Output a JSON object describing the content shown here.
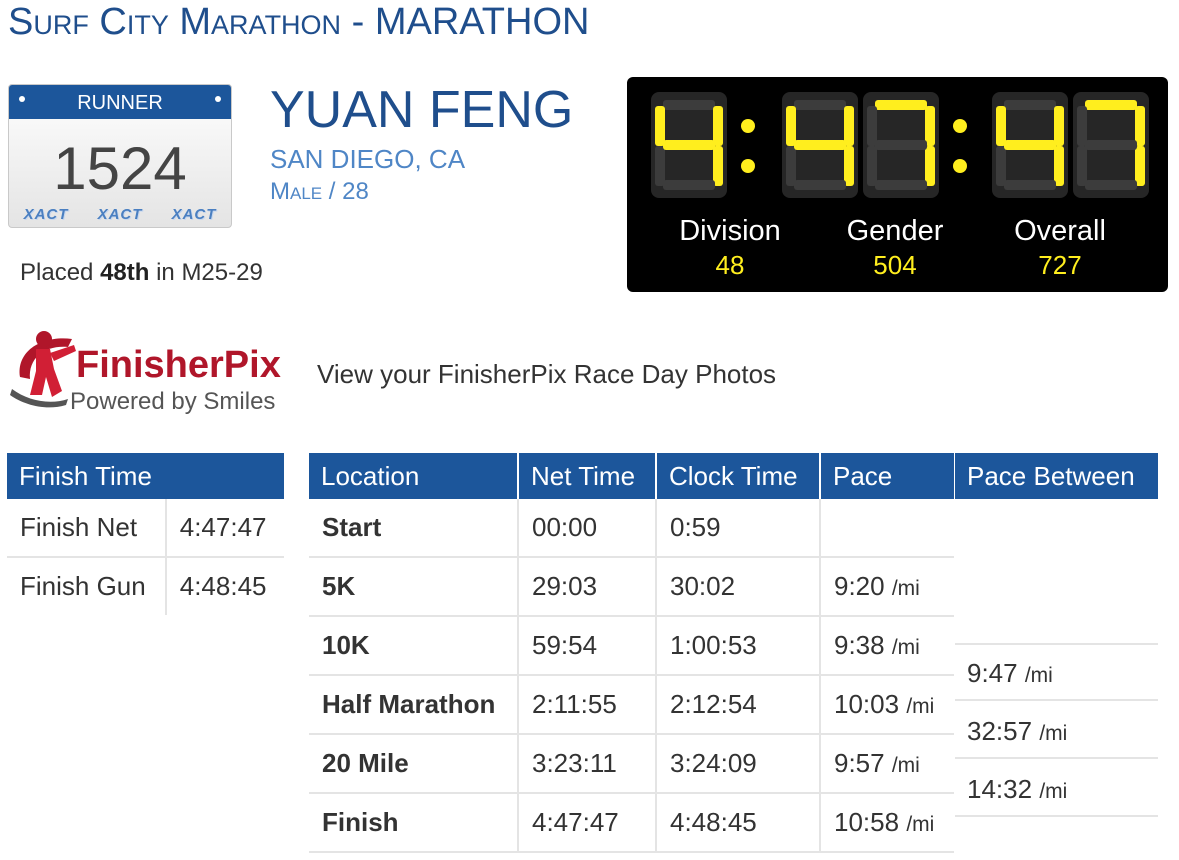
{
  "event": {
    "name": "Surf City Marathon",
    "sep": " - ",
    "race": "MARATHON"
  },
  "bib": {
    "header": "RUNNER",
    "number": "1524",
    "sponsor": [
      "XACT",
      "XACT",
      "XACT"
    ]
  },
  "runner": {
    "name": "YUAN FENG",
    "city": "SAN DIEGO, CA",
    "gender": "Male",
    "sep": " / ",
    "age": "28"
  },
  "placement": {
    "prefix": "Placed ",
    "place": "48th",
    "middle": " in ",
    "division": "M25-29"
  },
  "scoreboard": {
    "time": "4:47:47",
    "division": {
      "label": "Division",
      "value": "48"
    },
    "gender": {
      "label": "Gender",
      "value": "504"
    },
    "overall": {
      "label": "Overall",
      "value": "727"
    }
  },
  "finisherpix": {
    "logo_title": "FinisherPix",
    "logo_tagline": "Powered by Smiles",
    "link_text": "View your FinisherPix Race Day Photos"
  },
  "finish_time": {
    "header": "Finish Time",
    "rows": [
      {
        "label": "Finish Net",
        "value": "4:47:47"
      },
      {
        "label": "Finish Gun",
        "value": "4:48:45"
      }
    ]
  },
  "splits": {
    "headers": [
      "Location",
      "Net Time",
      "Clock Time",
      "Pace",
      "Pace Between"
    ],
    "pace_unit": "/mi",
    "rows": [
      {
        "location": "Start",
        "net": "00:00",
        "clock": "0:59",
        "pace": ""
      },
      {
        "location": "5K",
        "net": "29:03",
        "clock": "30:02",
        "pace": "9:20"
      },
      {
        "location": "10K",
        "net": "59:54",
        "clock": "1:00:53",
        "pace": "9:38"
      },
      {
        "location": "Half Marathon",
        "net": "2:11:55",
        "clock": "2:12:54",
        "pace": "10:03"
      },
      {
        "location": "20 Mile",
        "net": "3:23:11",
        "clock": "3:24:09",
        "pace": "9:57"
      },
      {
        "location": "Finish",
        "net": "4:47:47",
        "clock": "4:48:45",
        "pace": "10:58"
      }
    ],
    "pace_between": [
      "9:47",
      "32:57",
      "14:32"
    ]
  },
  "colors": {
    "brand_blue": "#1c569b",
    "title_blue": "#1f4e8c",
    "light_blue": "#4f86c6",
    "led_yellow": "#ffee1e",
    "board_bg": "#000000"
  }
}
